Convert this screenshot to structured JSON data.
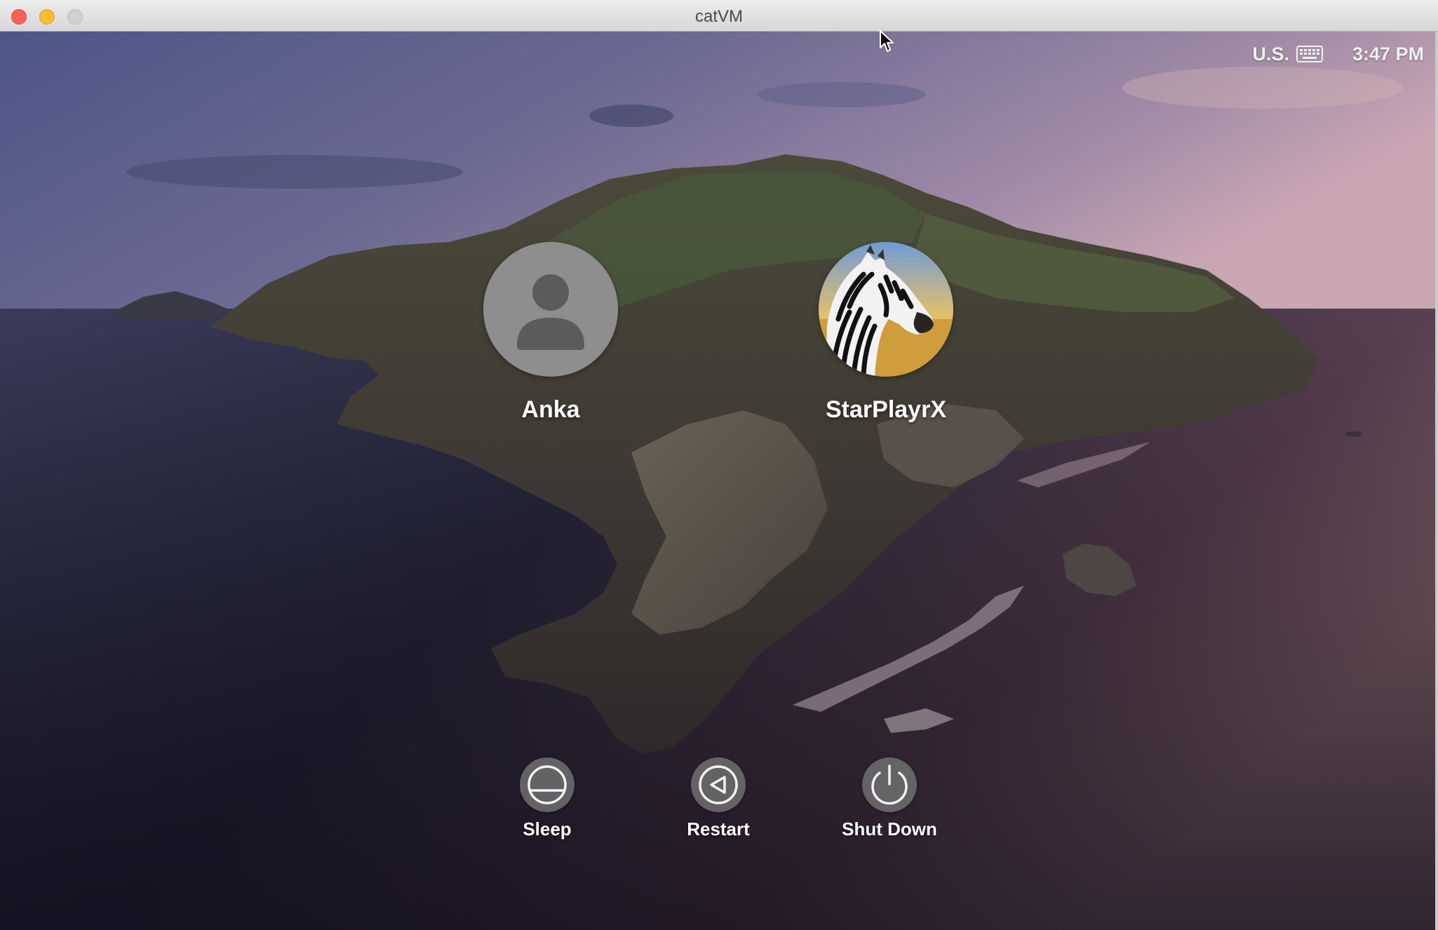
{
  "window": {
    "title": "catVM"
  },
  "menu_status": {
    "input_source": "U.S.",
    "keyboard_icon": "keyboard-icon",
    "time": "3:47 PM"
  },
  "users": [
    {
      "name": "Anka",
      "avatar_icon": "default-user-silhouette-icon"
    },
    {
      "name": "StarPlayrX",
      "avatar_icon": "zebra-avatar-image"
    }
  ],
  "power_buttons": [
    {
      "label": "Sleep",
      "icon": "sleep-icon"
    },
    {
      "label": "Restart",
      "icon": "restart-icon"
    },
    {
      "label": "Shut Down",
      "icon": "power-icon"
    }
  ],
  "colors": {
    "close": "#fc5f57",
    "minimize": "#fdbc2e",
    "zoom_disabled": "#d0d0d0",
    "button_fill": "#6e6e6e"
  }
}
